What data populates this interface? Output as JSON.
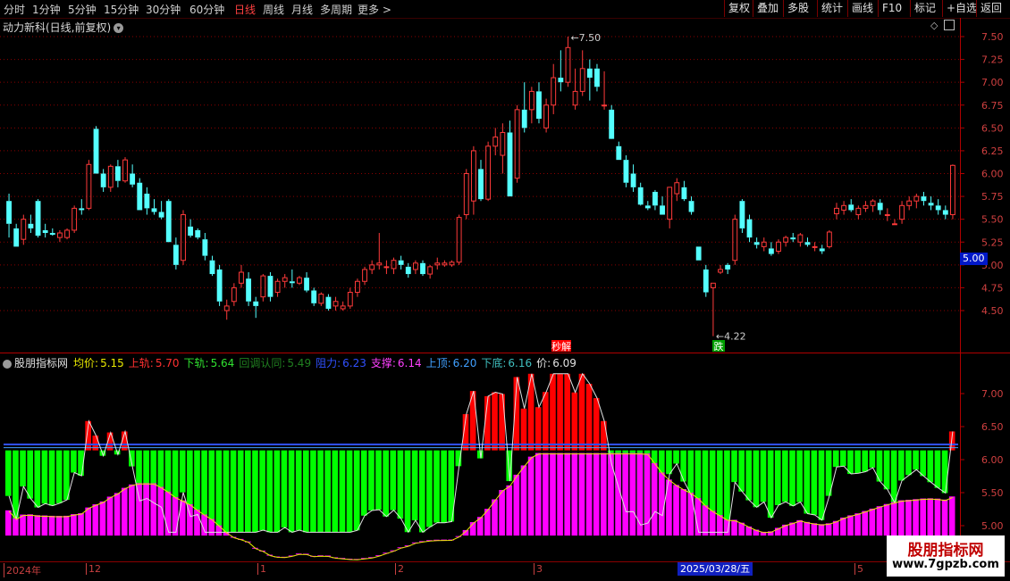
{
  "toolbar": {
    "timeframes": [
      {
        "label": "分时",
        "active": false
      },
      {
        "label": "1分钟",
        "active": false
      },
      {
        "label": "5分钟",
        "active": false
      },
      {
        "label": "15分钟",
        "active": false
      },
      {
        "label": "30分钟",
        "active": false
      },
      {
        "label": "60分钟",
        "active": false
      },
      {
        "label": "日线",
        "active": true
      },
      {
        "label": "周线",
        "active": false
      },
      {
        "label": "月线",
        "active": false
      },
      {
        "label": "多周期",
        "active": false
      },
      {
        "label": "更多 >",
        "active": false
      }
    ],
    "buttons": [
      "复权",
      "叠加",
      "多股",
      "统计",
      "画线",
      "F10",
      "标记",
      "+自选",
      "返回"
    ]
  },
  "main": {
    "title": "动力新科(日线,前复权)",
    "price_badge": "5.00",
    "high_label": "7.50",
    "low_label": "4.22",
    "signal_sell": "秒解",
    "signal_buy": "跌",
    "axis_ticks": [
      "7.50",
      "7.25",
      "7.00",
      "6.75",
      "6.50",
      "6.25",
      "6.00",
      "5.75",
      "5.50",
      "5.25",
      "5.00",
      "4.75",
      "4.50"
    ]
  },
  "indicator": {
    "name": "股朋指标网",
    "legend": [
      {
        "label": "均价:",
        "value": "5.15",
        "color": "#e8e800"
      },
      {
        "label": "上轨:",
        "value": "5.70",
        "color": "#ff3030"
      },
      {
        "label": "下轨:",
        "value": "5.64",
        "color": "#30e030"
      },
      {
        "label": "回调认同:",
        "value": "5.49",
        "color": "#208020"
      },
      {
        "label": "阻力:",
        "value": "6.23",
        "color": "#3050ff"
      },
      {
        "label": "支撑:",
        "value": "6.14",
        "color": "#ff40ff"
      },
      {
        "label": "上顶:",
        "value": "6.20",
        "color": "#40a0ff"
      },
      {
        "label": "下底:",
        "value": "6.16",
        "color": "#40c0c0"
      },
      {
        "label": "价:",
        "value": "6.09",
        "color": "#e0e0e0"
      }
    ],
    "axis_ticks": [
      "7.00",
      "6.50",
      "6.00",
      "5.50",
      "5.00"
    ]
  },
  "dates": {
    "labels": [
      "2024年",
      "12",
      "1",
      "2",
      "3",
      "5"
    ],
    "highlight": "2025/03/28/五"
  },
  "watermark": {
    "title": "股朋指标网",
    "url": "www.7gpzb.com"
  },
  "colors": {
    "up": "#ff3a3a",
    "down": "#54ffff",
    "grid": "#8a0000",
    "green_bar": "#00ff00",
    "magenta_bar": "#ff00ff",
    "red_bar": "#ff0000"
  },
  "chart_data": {
    "type": "candlestick",
    "ylim": [
      4.22,
      7.62
    ],
    "series": [
      {
        "name": "OHLC",
        "ohlc": [
          [
            5.7,
            5.78,
            5.3,
            5.45
          ],
          [
            5.4,
            5.45,
            5.2,
            5.2
          ],
          [
            5.28,
            5.55,
            5.22,
            5.5
          ],
          [
            5.45,
            5.55,
            5.35,
            5.4
          ],
          [
            5.7,
            5.72,
            5.3,
            5.32
          ],
          [
            5.38,
            5.45,
            5.3,
            5.35
          ],
          [
            5.35,
            5.4,
            5.32,
            5.33
          ],
          [
            5.3,
            5.38,
            5.25,
            5.35
          ],
          [
            5.3,
            5.4,
            5.28,
            5.38
          ],
          [
            5.38,
            5.65,
            5.35,
            5.62
          ],
          [
            5.62,
            5.72,
            5.55,
            5.6
          ],
          [
            5.62,
            6.15,
            5.6,
            6.1
          ],
          [
            6.49,
            6.52,
            6.0,
            6.0
          ],
          [
            6.0,
            6.05,
            5.8,
            5.85
          ],
          [
            5.85,
            6.1,
            5.8,
            6.08
          ],
          [
            6.08,
            6.15,
            5.85,
            5.92
          ],
          [
            5.92,
            6.18,
            5.9,
            6.15
          ],
          [
            6.0,
            6.1,
            5.85,
            5.88
          ],
          [
            5.9,
            5.95,
            5.6,
            5.6
          ],
          [
            5.78,
            5.85,
            5.55,
            5.62
          ],
          [
            5.62,
            5.72,
            5.55,
            5.58
          ],
          [
            5.58,
            5.7,
            5.5,
            5.52
          ],
          [
            5.7,
            5.72,
            5.25,
            5.25
          ],
          [
            5.22,
            5.3,
            4.95,
            5.0
          ],
          [
            5.05,
            5.6,
            5.0,
            5.55
          ],
          [
            5.42,
            5.5,
            5.3,
            5.32
          ],
          [
            5.38,
            5.4,
            5.28,
            5.3
          ],
          [
            5.28,
            5.35,
            5.05,
            5.1
          ],
          [
            5.05,
            5.1,
            4.88,
            4.9
          ],
          [
            4.95,
            5.0,
            4.55,
            4.6
          ],
          [
            4.5,
            4.62,
            4.4,
            4.55
          ],
          [
            4.6,
            4.8,
            4.55,
            4.75
          ],
          [
            4.8,
            5.0,
            4.75,
            4.92
          ],
          [
            4.85,
            4.92,
            4.55,
            4.6
          ],
          [
            4.6,
            4.65,
            4.42,
            4.55
          ],
          [
            4.65,
            4.9,
            4.6,
            4.88
          ],
          [
            4.88,
            4.92,
            4.6,
            4.65
          ],
          [
            4.7,
            4.85,
            4.65,
            4.82
          ],
          [
            4.82,
            4.9,
            4.75,
            4.86
          ],
          [
            4.82,
            4.95,
            4.75,
            4.8
          ],
          [
            4.8,
            4.88,
            4.78,
            4.86
          ],
          [
            4.86,
            4.92,
            4.7,
            4.72
          ],
          [
            4.72,
            4.75,
            4.55,
            4.58
          ],
          [
            4.58,
            4.7,
            4.55,
            4.68
          ],
          [
            4.65,
            4.68,
            4.5,
            4.52
          ],
          [
            4.55,
            4.65,
            4.5,
            4.6
          ],
          [
            4.52,
            4.6,
            4.5,
            4.55
          ],
          [
            4.55,
            4.75,
            4.52,
            4.7
          ],
          [
            4.7,
            4.85,
            4.65,
            4.82
          ],
          [
            4.82,
            4.98,
            4.78,
            4.95
          ],
          [
            4.95,
            5.05,
            4.9,
            5.0
          ],
          [
            5.0,
            5.35,
            4.95,
            5.02
          ],
          [
            4.98,
            5.05,
            4.9,
            4.98
          ],
          [
            4.96,
            5.08,
            4.9,
            5.05
          ],
          [
            5.05,
            5.1,
            4.95,
            5.0
          ],
          [
            4.98,
            5.02,
            4.86,
            4.9
          ],
          [
            4.95,
            5.05,
            4.9,
            5.02
          ],
          [
            5.02,
            5.05,
            4.88,
            4.9
          ],
          [
            4.9,
            5.0,
            4.85,
            4.98
          ],
          [
            5.0,
            5.08,
            4.95,
            5.02
          ],
          [
            5.0,
            5.05,
            4.98,
            5.02
          ],
          [
            5.0,
            5.05,
            4.98,
            5.03
          ],
          [
            5.03,
            5.55,
            5.0,
            5.52
          ],
          [
            5.55,
            6.05,
            5.5,
            6.0
          ],
          [
            5.7,
            6.3,
            5.55,
            6.25
          ],
          [
            6.05,
            6.15,
            5.7,
            5.72
          ],
          [
            5.72,
            6.35,
            5.7,
            6.3
          ],
          [
            6.3,
            6.5,
            6.2,
            6.4
          ],
          [
            6.2,
            6.55,
            6.0,
            6.45
          ],
          [
            6.45,
            6.58,
            5.75,
            5.75
          ],
          [
            5.95,
            6.75,
            5.9,
            6.7
          ],
          [
            6.7,
            7.0,
            6.45,
            6.5
          ],
          [
            6.7,
            6.95,
            6.55,
            6.9
          ],
          [
            6.9,
            7.0,
            6.55,
            6.6
          ],
          [
            6.5,
            6.82,
            6.45,
            6.75
          ],
          [
            6.75,
            7.2,
            6.65,
            7.05
          ],
          [
            7.05,
            7.35,
            6.9,
            7.0
          ],
          [
            7.0,
            7.5,
            6.95,
            7.38
          ],
          [
            6.75,
            7.15,
            6.7,
            6.9
          ],
          [
            6.9,
            7.35,
            6.85,
            7.15
          ],
          [
            7.15,
            7.25,
            6.8,
            7.05
          ],
          [
            7.15,
            7.2,
            6.9,
            6.95
          ],
          [
            6.75,
            7.12,
            6.7,
            6.75
          ],
          [
            6.7,
            6.75,
            6.4,
            6.38
          ],
          [
            6.3,
            6.35,
            6.15,
            6.15
          ],
          [
            6.15,
            6.2,
            5.85,
            5.9
          ],
          [
            6.0,
            6.1,
            5.8,
            5.85
          ],
          [
            5.85,
            5.9,
            5.65,
            5.66
          ],
          [
            5.65,
            5.7,
            5.6,
            5.62
          ],
          [
            5.8,
            5.82,
            5.6,
            5.65
          ],
          [
            5.65,
            5.75,
            5.55,
            5.55
          ],
          [
            5.5,
            5.85,
            5.4,
            5.85
          ],
          [
            5.78,
            5.95,
            5.7,
            5.9
          ],
          [
            5.85,
            5.92,
            5.7,
            5.72
          ],
          [
            5.7,
            5.75,
            5.55,
            5.58
          ],
          [
            5.2,
            5.2,
            5.05,
            5.05
          ],
          [
            4.95,
            5.0,
            4.65,
            4.7
          ],
          [
            4.75,
            4.8,
            4.22,
            4.8
          ],
          [
            4.92,
            5.0,
            4.9,
            4.95
          ],
          [
            5.0,
            5.02,
            4.9,
            4.95
          ],
          [
            5.05,
            5.55,
            5.0,
            5.5
          ],
          [
            5.7,
            5.72,
            5.35,
            5.4
          ],
          [
            5.5,
            5.55,
            5.25,
            5.3
          ],
          [
            5.25,
            5.3,
            5.18,
            5.22
          ],
          [
            5.2,
            5.3,
            5.15,
            5.25
          ],
          [
            5.18,
            5.25,
            5.1,
            5.12
          ],
          [
            5.15,
            5.28,
            5.12,
            5.25
          ],
          [
            5.25,
            5.32,
            5.2,
            5.3
          ],
          [
            5.3,
            5.35,
            5.25,
            5.28
          ],
          [
            5.25,
            5.35,
            5.2,
            5.33
          ],
          [
            5.25,
            5.3,
            5.2,
            5.22
          ],
          [
            5.2,
            5.25,
            5.15,
            5.2
          ],
          [
            5.18,
            5.22,
            5.12,
            5.15
          ],
          [
            5.2,
            5.38,
            5.18,
            5.36
          ],
          [
            5.56,
            5.68,
            5.5,
            5.62
          ],
          [
            5.6,
            5.7,
            5.55,
            5.65
          ],
          [
            5.66,
            5.72,
            5.58,
            5.6
          ],
          [
            5.55,
            5.65,
            5.5,
            5.62
          ],
          [
            5.62,
            5.7,
            5.58,
            5.65
          ],
          [
            5.65,
            5.72,
            5.58,
            5.7
          ],
          [
            5.68,
            5.72,
            5.55,
            5.6
          ],
          [
            5.55,
            5.62,
            5.48,
            5.55
          ],
          [
            5.45,
            5.5,
            5.45,
            5.45
          ],
          [
            5.5,
            5.7,
            5.45,
            5.65
          ],
          [
            5.65,
            5.75,
            5.6,
            5.7
          ],
          [
            5.7,
            5.78,
            5.62,
            5.75
          ],
          [
            5.75,
            5.8,
            5.65,
            5.7
          ],
          [
            5.68,
            5.75,
            5.6,
            5.65
          ],
          [
            5.65,
            5.72,
            5.55,
            5.6
          ],
          [
            5.6,
            5.65,
            5.5,
            5.55
          ],
          [
            5.55,
            6.1,
            5.5,
            6.09
          ]
        ]
      }
    ],
    "indicator": {
      "type": "bar",
      "ylim": [
        4.8,
        7.35
      ],
      "resistance": 6.23,
      "support": 6.14
    }
  }
}
